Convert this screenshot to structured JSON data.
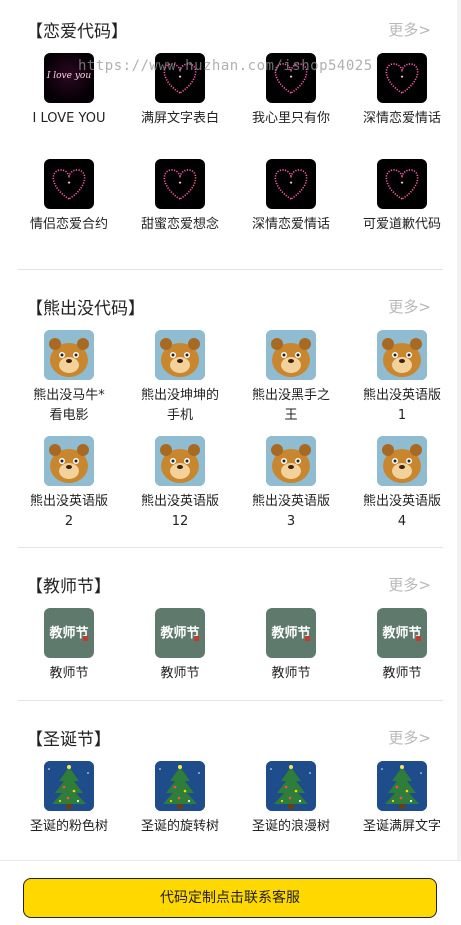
{
  "sections": [
    {
      "title": "【恋爱代码】",
      "more": "更多>",
      "items": [
        {
          "label": "I LOVE YOU",
          "thumb": "love-text-thumb",
          "thumb_text": "I love you"
        },
        {
          "label": "满屏文字表白",
          "thumb": "pink-heart-thumb"
        },
        {
          "label": "我心里只有你",
          "thumb": "pink-heart-thumb"
        },
        {
          "label": "深情恋爱情话",
          "thumb": "pink-heart-thumb"
        },
        {
          "label": "情侣恋爱合约",
          "thumb": "pink-heart-thumb"
        },
        {
          "label": "甜蜜恋爱想念",
          "thumb": "pink-heart-thumb"
        },
        {
          "label": "深情恋爱情话",
          "thumb": "pink-heart-thumb"
        },
        {
          "label": "可爱道歉代码",
          "thumb": "pink-heart-thumb"
        }
      ]
    },
    {
      "title": "【熊出没代码】",
      "more": "更多>",
      "items": [
        {
          "label": "熊出没马牛*看电影",
          "thumb": "bear-thumb"
        },
        {
          "label": "熊出没坤坤的手机",
          "thumb": "bear-thumb"
        },
        {
          "label": "熊出没黑手之王",
          "thumb": "bear-thumb"
        },
        {
          "label": "熊出没英语版1",
          "thumb": "bear-thumb"
        },
        {
          "label": "熊出没英语版2",
          "thumb": "bear-thumb"
        },
        {
          "label": "熊出没英语版12",
          "thumb": "bear-thumb"
        },
        {
          "label": "熊出没英语版3",
          "thumb": "bear-thumb"
        },
        {
          "label": "熊出没英语版4",
          "thumb": "bear-thumb"
        }
      ]
    },
    {
      "title": "【教师节】",
      "more": "更多>",
      "items": [
        {
          "label": "教师节",
          "thumb": "teachers-day-thumb",
          "thumb_text": "教师节"
        },
        {
          "label": "教师节",
          "thumb": "teachers-day-thumb",
          "thumb_text": "教师节"
        },
        {
          "label": "教师节",
          "thumb": "teachers-day-thumb",
          "thumb_text": "教师节"
        },
        {
          "label": "教师节",
          "thumb": "teachers-day-thumb",
          "thumb_text": "教师节"
        }
      ]
    },
    {
      "title": "【圣诞节】",
      "more": "更多>",
      "items": [
        {
          "label": "圣诞的粉色树",
          "thumb": "christmas-tree-thumb"
        },
        {
          "label": "圣诞的旋转树",
          "thumb": "christmas-tree-thumb"
        },
        {
          "label": "圣诞的浪漫树",
          "thumb": "christmas-tree-thumb"
        },
        {
          "label": "圣诞满屏文字",
          "thumb": "christmas-tree-thumb"
        }
      ]
    }
  ],
  "watermark": "https://www.huzhan.com/ishop54025",
  "cta_label": "代码定制点击联系客服",
  "colors": {
    "cta_background": "#ffd800",
    "more_link": "#b8b8b8",
    "divider": "#e4e4e4",
    "heart_pink": "#ff5fa8"
  }
}
